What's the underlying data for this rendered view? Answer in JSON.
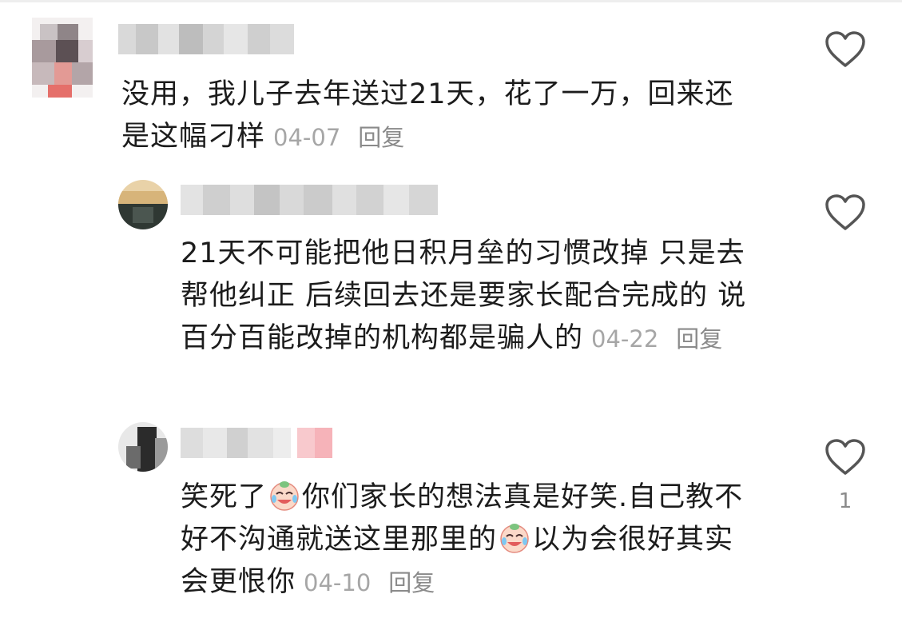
{
  "comments": [
    {
      "text": "没用，我儿子去年送过21天，花了一万，回来还是这幅刁样",
      "date": "04-07",
      "reply_label": "回复",
      "like_count": ""
    },
    {
      "text": "21天不可能把他日积月垒的习惯改掉 只是去帮他纠正 后续回去还是要家长配合完成的 说百分百能改掉的机构都是骗人的",
      "date": "04-22",
      "reply_label": "回复",
      "like_count": ""
    },
    {
      "text_parts": [
        "笑死了",
        "你们家长的想法真是好笑.自己教不好不沟通就送这里那里的",
        "以为会很好其实会更恨你"
      ],
      "date": "04-10",
      "reply_label": "回复",
      "like_count": "1",
      "emoji_name": "crying-laughing-emoji"
    }
  ],
  "icons": {
    "like": "heart-outline-icon"
  },
  "colors": {
    "text": "#1c1c1c",
    "meta": "#a6a6a6",
    "reply": "#8a8a8a",
    "heart_stroke": "#555555"
  }
}
